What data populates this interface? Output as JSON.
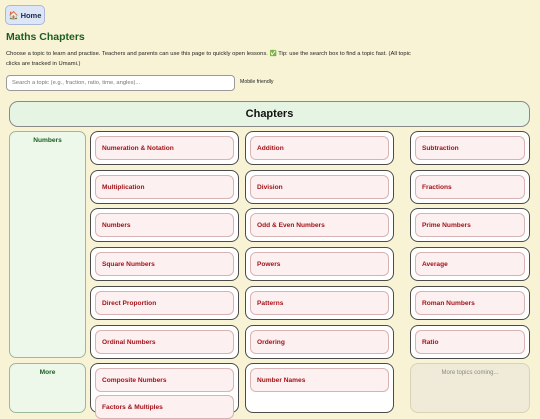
{
  "nav": {
    "home_icon": "🏠",
    "home_label": "Home"
  },
  "page": {
    "title": "Maths Chapters",
    "intro": "Choose a topic to learn and practise. Teachers and parents can use this page to quickly open lessons. ✅ Tip: use the search box to find a topic fast. (All topic clicks are tracked in Umami.)"
  },
  "search": {
    "placeholder": "Search a topic (e.g., fraction, ratio, time, angles)...",
    "value": "",
    "note": "Mobile friendly"
  },
  "chapters": {
    "heading": "Chapters",
    "categories": [
      {
        "name": "Numbers",
        "topics": [
          "Numeration & Notation",
          "Addition",
          "Subtraction",
          "Multiplication",
          "Division",
          "Fractions",
          "Numbers",
          "Odd & Even Numbers",
          "Prime Numbers",
          "Square Numbers",
          "Powers",
          "Average",
          "Direct Proportion",
          "Patterns",
          "Roman Numbers",
          "Ordinal Numbers",
          "Ordering",
          "Ratio"
        ]
      },
      {
        "name": "More",
        "topics": [
          "Composite Numbers",
          "Number Names",
          "Factors & Multiples"
        ],
        "placeholder": "More topics coming..."
      }
    ]
  },
  "colors": {
    "background": "#f8f3d5",
    "title_green": "#1b5e20",
    "topic_red": "#a3121a",
    "header_bg": "#e6f4e3"
  }
}
